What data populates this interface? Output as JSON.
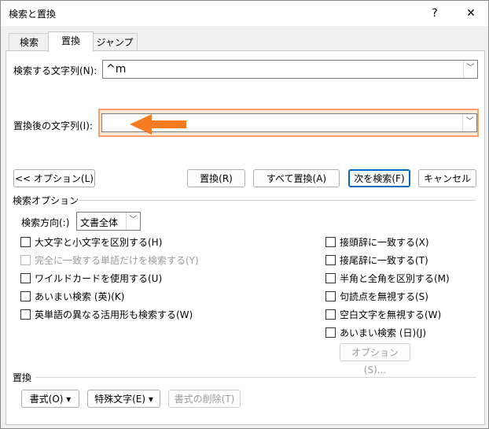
{
  "window": {
    "title": "検索と置換",
    "help": "?",
    "close": "✕"
  },
  "tabs": [
    {
      "label": "検索"
    },
    {
      "label": "置換"
    },
    {
      "label": "ジャンプ"
    }
  ],
  "find": {
    "label": "検索する文字列(N):",
    "value": "^m"
  },
  "replace": {
    "label": "置換後の文字列(I):",
    "value": ""
  },
  "buttons": {
    "options": "<< オプション(L)",
    "replace": "置換(R)",
    "replace_all": "すべて置換(A)",
    "find_next": "次を検索(F)",
    "cancel": "キャンセル"
  },
  "search_options": {
    "heading": "検索オプション",
    "direction_label": "検索方向(:)",
    "direction_value": "文書全体",
    "left_checks": [
      "大文字と小文字を区別する(H)",
      "完全に一致する単語だけを検索する(Y)",
      "ワイルドカードを使用する(U)",
      "あいまい検索 (英)(K)",
      "英単語の異なる活用形も検索する(W)"
    ],
    "right_checks": [
      "接頭辞に一致する(X)",
      "接尾辞に一致する(T)",
      "半角と全角を区別する(M)",
      "句読点を無視する(S)",
      "空白文字を無視する(W)",
      "あいまい検索 (日)(J)"
    ],
    "options_button": "オプション(S)..."
  },
  "replace_section": {
    "heading": "置換",
    "format_button": "書式(O) ▾",
    "special_button": "特殊文字(E) ▾",
    "clear_format_button": "書式の削除(T)"
  },
  "accent_color": "#f47b20"
}
